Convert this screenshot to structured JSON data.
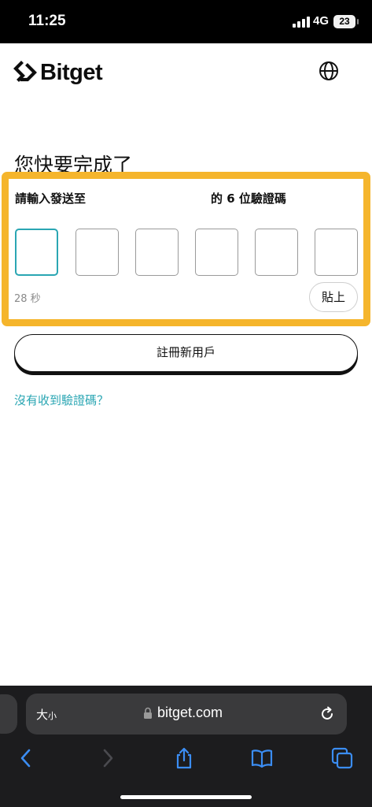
{
  "status_bar": {
    "time": "11:25",
    "network": "4G",
    "battery": "23"
  },
  "header": {
    "brand": "Bitget",
    "globe_icon": "globe-icon"
  },
  "page": {
    "title": "您快要完成了",
    "instruction_prefix": "請輸入發送至",
    "instruction_suffix": "的 6 位驗證碼",
    "code_length": 6,
    "active_box_index": 0,
    "countdown": "28 秒",
    "paste_label": "貼上",
    "register_label": "註冊新用戶",
    "resend_link": "沒有收到驗證碼？",
    "accent_color": "#2aa6b3",
    "highlight_color": "#f5b52c"
  },
  "browser": {
    "text_size_label": "大",
    "text_size_small": "小",
    "url": "bitget.com",
    "toolbar": [
      "back-icon",
      "forward-icon",
      "share-icon",
      "bookmarks-icon",
      "tabs-icon"
    ]
  }
}
